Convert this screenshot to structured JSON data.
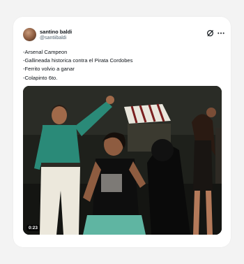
{
  "author": {
    "name": "santino baldi",
    "handle": "@santiibaldi"
  },
  "tweet": {
    "lines": [
      "-Arsenal Campeon",
      "-Gallineada historica contra el Pirata Cordobes",
      "-Ferrito volvio a ganar",
      "-Colapinto 6to."
    ]
  },
  "media": {
    "duration": "0:23"
  },
  "icons": {
    "grok": "grok-icon",
    "more": "more-options-icon"
  }
}
